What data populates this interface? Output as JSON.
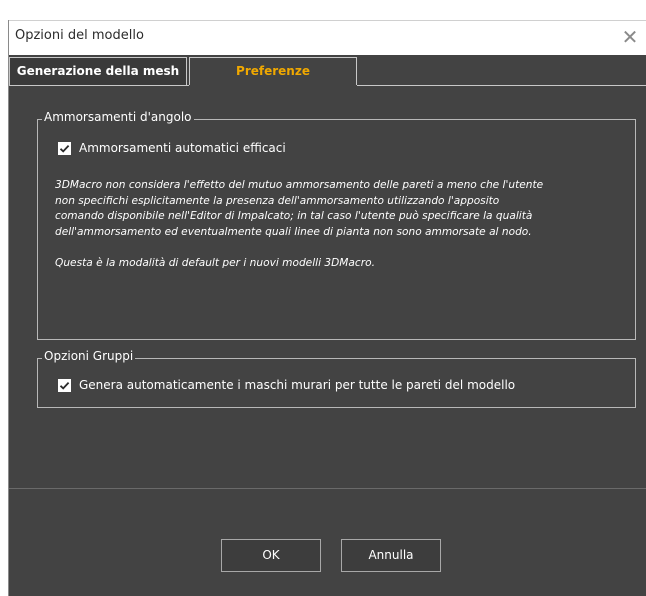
{
  "window": {
    "title": "Opzioni del modello",
    "close_glyph": "✕"
  },
  "tabs": [
    {
      "label": "Generazione della mesh",
      "active": false
    },
    {
      "label": "Preferenze",
      "active": true,
      "active_color": "#f0a800"
    }
  ],
  "groups": {
    "corner": {
      "legend": "Ammorsamenti d'angolo",
      "checkbox": {
        "label": "Ammorsamenti automatici efficaci",
        "checked": true
      },
      "description": [
        "3DMacro non considera l'effetto del mutuo ammorsamento delle pareti a meno che l'utente",
        "non specifichi esplicitamente la presenza dell'ammorsamento utilizzando l'apposito",
        "comando disponibile nell'Editor di Impalcato; in tal caso l'utente può specificare la qualità",
        "dell'ammorsamento ed eventualmente quali linee di pianta non sono ammorsate al nodo."
      ],
      "note": "Questa è la modalità di default per i nuovi modelli 3DMacro."
    },
    "groups_options": {
      "legend": "Opzioni Gruppi",
      "checkbox": {
        "label": "Genera automaticamente i maschi murari per tutte le pareti del modello",
        "checked": true
      }
    }
  },
  "buttons": {
    "ok": "OK",
    "cancel": "Annulla"
  },
  "colors": {
    "dialog_bg": "#434343",
    "accent": "#f0a800"
  }
}
